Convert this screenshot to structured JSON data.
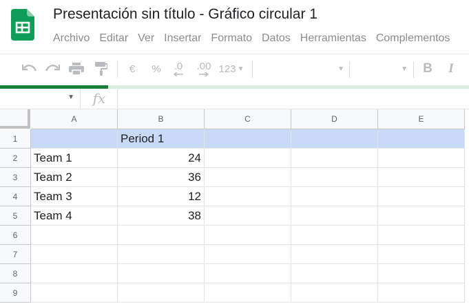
{
  "app": {
    "title": "Presentación sin título - Gráfico circular 1",
    "menu": [
      "Archivo",
      "Editar",
      "Ver",
      "Insertar",
      "Formato",
      "Datos",
      "Herramientas",
      "Complementos"
    ]
  },
  "toolbar": {
    "currency": "€",
    "percent": "%",
    "decrease_decimals": ".0",
    "increase_decimals": ".00",
    "more_formats": "123",
    "bold": "B",
    "italic": "I"
  },
  "loading_progress": 0.23,
  "formula_bar": {
    "fx_label": "fx"
  },
  "sheet": {
    "columns": [
      "A",
      "B",
      "C",
      "D",
      "E"
    ],
    "rows": [
      "1",
      "2",
      "3",
      "4",
      "5",
      "6",
      "7",
      "8",
      "9"
    ],
    "cells": {
      "B1": "Period 1",
      "A2": "Team 1",
      "B2": "24",
      "A3": "Team 2",
      "B3": "36",
      "A4": "Team 3",
      "B4": "12",
      "A5": "Team 4",
      "B5": "38"
    }
  },
  "colors": {
    "selection": "#c9daf8",
    "brand_green": "#188038",
    "sheets_icon": "#0f9d58"
  }
}
